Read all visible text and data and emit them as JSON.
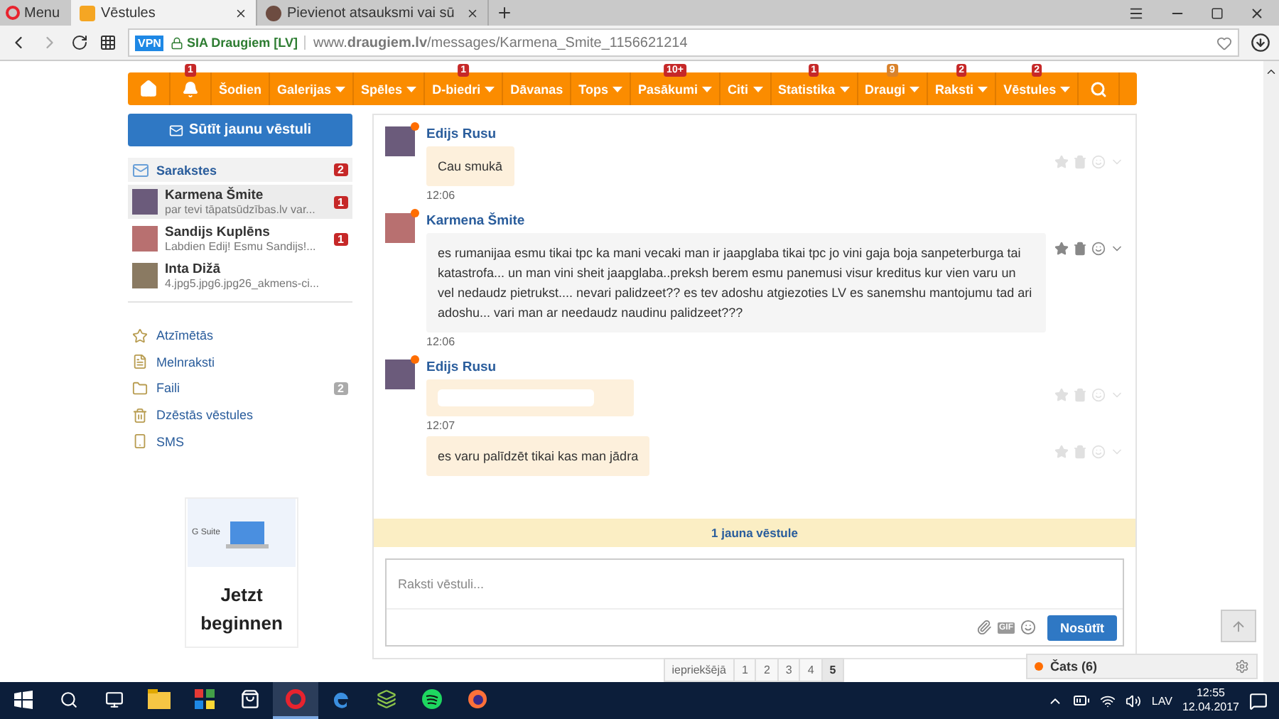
{
  "browser": {
    "menu_label": "Menu",
    "tabs": [
      {
        "title": "Vēstules",
        "selected": true
      },
      {
        "title": "Pievienot atsauksmi vai sū",
        "selected": false
      }
    ],
    "address": {
      "vpn": "VPN",
      "certificate": "SIA Draugiem [LV]",
      "url": "www.**draugiem.lv**/messages/Karmena_Smite_1156621214"
    }
  },
  "nav": {
    "items": [
      {
        "kind": "home"
      },
      {
        "kind": "bell",
        "badge": {
          "text": "1",
          "color": "#c62828"
        }
      },
      {
        "kind": "text",
        "label": "Šodien",
        "dropdown": false
      },
      {
        "kind": "text",
        "label": "Galerijas",
        "dropdown": true
      },
      {
        "kind": "text",
        "label": "Spēles",
        "dropdown": true
      },
      {
        "kind": "text",
        "label": "D-biedri",
        "dropdown": true,
        "badge": {
          "text": "1",
          "color": "#c62828"
        }
      },
      {
        "kind": "text",
        "label": "Dāvanas",
        "dropdown": false
      },
      {
        "kind": "text",
        "label": "Tops",
        "dropdown": true
      },
      {
        "kind": "text",
        "label": "Pasākumi",
        "dropdown": true,
        "badge": {
          "text": "10+",
          "color": "#c62828"
        }
      },
      {
        "kind": "text",
        "label": "Citi",
        "dropdown": true
      },
      {
        "kind": "text",
        "label": "Statistika",
        "dropdown": true,
        "badge": {
          "text": "1",
          "color": "#c62828"
        }
      },
      {
        "kind": "text",
        "label": "Draugi",
        "dropdown": true,
        "badge": {
          "text": "9",
          "color": "#d9822b"
        }
      },
      {
        "kind": "text",
        "label": "Raksti",
        "dropdown": true,
        "badge": {
          "text": "2",
          "color": "#c62828"
        }
      },
      {
        "kind": "text",
        "label": "Vēstules",
        "dropdown": true,
        "badge": {
          "text": "2",
          "color": "#c62828"
        }
      },
      {
        "kind": "search"
      }
    ]
  },
  "sidebar": {
    "compose_button": "Sūtīt jaunu vēstuli",
    "inbox": {
      "label": "Sarakstes",
      "count": "2"
    },
    "conversations": [
      {
        "name": "Karmena Šmite",
        "preview": "par tevi tāpatsūdzības.lv var...",
        "unread": "1",
        "selected": true
      },
      {
        "name": "Sandijs Kuplēns",
        "preview": "Labdien Edij! Esmu Sandijs!...",
        "unread": "1",
        "selected": false
      },
      {
        "name": "Inta Dižā",
        "preview": "4.jpg5.jpg6.jpg26_akmens-ci...",
        "selected": false
      }
    ],
    "links": [
      {
        "kind": "starred",
        "label": "Atzīmētās"
      },
      {
        "kind": "drafts",
        "label": "Melnraksti"
      },
      {
        "kind": "files",
        "label": "Faili",
        "count": "2"
      },
      {
        "kind": "trash",
        "label": "Dzēstās vēstules"
      },
      {
        "kind": "sms",
        "label": "SMS"
      }
    ],
    "ad": {
      "brand": "G Suite",
      "headline": "Jetzt beginnen"
    }
  },
  "conversation": {
    "groups": [
      {
        "sender": "Edijs Rusu",
        "online": true,
        "own": true,
        "messages": [
          {
            "text": "Cau smukā",
            "time": "12:06",
            "hovered": false
          }
        ]
      },
      {
        "sender": "Karmena Šmite",
        "online": true,
        "own": false,
        "messages": [
          {
            "text": "es rumanijaa esmu tikai tpc ka mani vecaki man ir jaapglaba tikai tpc jo vini gaja boja sanpeterburga tai katastrofa... un man vini sheit jaapglaba..preksh berem esmu panemusi visur kreditus kur vien varu un vel nedaudz pietrukst.... nevari palidzeet?? es tev adoshu atgiezoties LV es sanemshu mantojumu tad ari adoshu... vari man ar needaudz naudinu palidzeet???",
            "time": "12:06",
            "hovered": true
          }
        ]
      },
      {
        "sender": "Edijs Rusu",
        "online": true,
        "own": true,
        "messages": [
          {
            "kind": "redacted",
            "time": "12:07",
            "hovered": false
          },
          {
            "text": "es varu palīdzēt tikai kas man jādra",
            "hovered": false
          }
        ]
      }
    ],
    "new_messages": "1 jauna vēstule",
    "composer": {
      "placeholder": "Raksti vēstuli...",
      "gif": "GIF",
      "send": "Nosūtīt"
    }
  },
  "pagination": {
    "previous": "iepriekšējā",
    "pages": [
      {
        "label": "1",
        "selected": false
      },
      {
        "label": "2",
        "selected": false
      },
      {
        "label": "3",
        "selected": false
      },
      {
        "label": "4",
        "selected": false
      },
      {
        "label": "5",
        "selected": true
      }
    ]
  },
  "chat": {
    "label": "Čats (6)",
    "online": true
  },
  "taskbar": {
    "apps": [
      {
        "kind": "explorer",
        "active": false
      },
      {
        "kind": "tiles",
        "active": false
      },
      {
        "kind": "store",
        "active": false
      },
      {
        "kind": "opera",
        "active": true
      },
      {
        "kind": "edge",
        "active": false
      },
      {
        "kind": "app",
        "active": false
      },
      {
        "kind": "spotify",
        "active": false
      },
      {
        "kind": "firefox",
        "active": false
      }
    ],
    "language": "LAV",
    "time": "12:55",
    "date": "12.04.2017"
  }
}
